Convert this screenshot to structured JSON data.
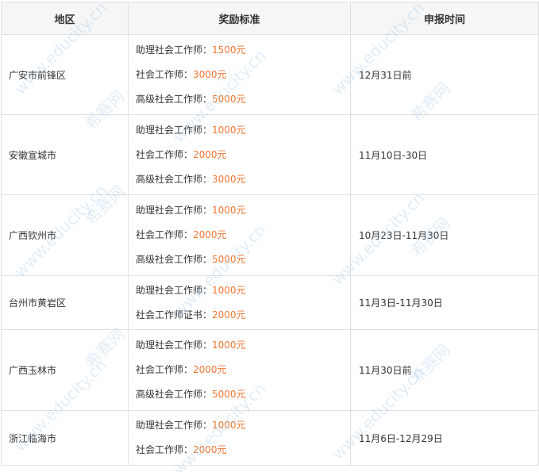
{
  "table": {
    "headers": [
      "地区",
      "奖励标准",
      "申报时间"
    ],
    "rows": [
      {
        "region": "广安市前锋区",
        "rewards": [
          {
            "label": "助理社会工作师：",
            "amount": "1500元"
          },
          {
            "label": "社会工作师：",
            "amount": "3000元"
          },
          {
            "label": "高级社会工作师：",
            "amount": "5000元"
          }
        ],
        "dates": "12月31日前"
      },
      {
        "region": "安徽宣城市",
        "rewards": [
          {
            "label": "助理社会工作师：",
            "amount": "1000元"
          },
          {
            "label": "社会工作师：",
            "amount": "2000元"
          },
          {
            "label": "高级社会工作师：",
            "amount": "3000元"
          }
        ],
        "dates": "11月10日-30日"
      },
      {
        "region": "广西钦州市",
        "rewards": [
          {
            "label": "助理社会工作师：",
            "amount": "1000元"
          },
          {
            "label": "社会工作师：",
            "amount": "2000元"
          },
          {
            "label": "高级社会工作师：",
            "amount": "5000元"
          }
        ],
        "dates": "10月23日-11月30日"
      },
      {
        "region": "台州市黄岩区",
        "rewards": [
          {
            "label": "助理社会工作师：",
            "amount": "1000元"
          },
          {
            "label": "社会工作师证书：",
            "amount": "2000元"
          }
        ],
        "dates": "11月3日-11月30日"
      },
      {
        "region": "广西玉林市",
        "rewards": [
          {
            "label": "助理社会工作师：",
            "amount": "1000元"
          },
          {
            "label": "社会工作师：",
            "amount": "2000元"
          },
          {
            "label": "高级社会工作师：",
            "amount": "5000元"
          }
        ],
        "dates": "11月30日前"
      },
      {
        "region": "浙江临海市",
        "rewards": [
          {
            "label": "助理社会工作师：",
            "amount": "1000元"
          },
          {
            "label": "社会工作师：",
            "amount": "2000元"
          }
        ],
        "dates": "11月6日-12月29日"
      }
    ]
  },
  "watermark": {
    "brand": "希赛网",
    "url": "www.educity.cn"
  },
  "colors": {
    "amount": "#ee7733",
    "header_bg": "#f6f6f6",
    "border": "#e0e0e0",
    "watermark": "#96bee1"
  }
}
